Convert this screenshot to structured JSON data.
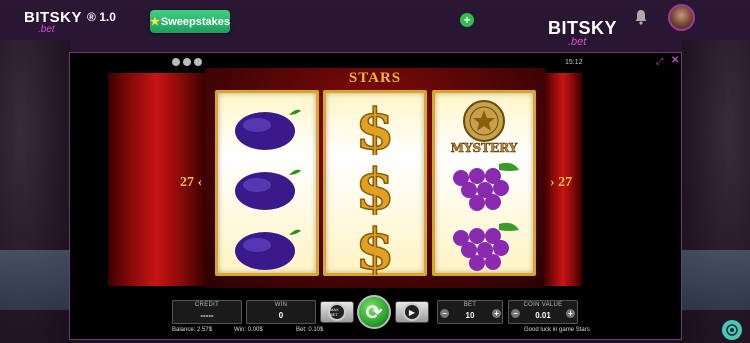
{
  "header": {
    "logo_text": "BITSKY",
    "logo_sub": ".bet",
    "version": "® 1.0",
    "sweep_label": "Sweepstakes",
    "logo2_text": "BITSKY",
    "logo2_sub": ".bet"
  },
  "colors": {
    "accent": "#e04bd6",
    "sweep_green": "#2fbf6a",
    "reel_gold": "#d9a62a",
    "curtain_red": "#c81414"
  },
  "game": {
    "title": "STARS",
    "lines_left": "27",
    "lines_right": "27",
    "clock": "15:12",
    "reels": [
      [
        "plum",
        "plum",
        "plum"
      ],
      [
        "dollar",
        "dollar",
        "dollar"
      ],
      [
        "mystery",
        "grapes",
        "grapes"
      ]
    ],
    "mystery_label": "MYSTERY"
  },
  "panel": {
    "credit_label": "CREDIT",
    "credit_value": "-----",
    "win_label": "WIN",
    "win_value": "0",
    "bet_label": "BET",
    "bet_value": "10",
    "coin_label": "COIN VALUE",
    "coin_value": "0.01",
    "maxbet_label": "MAX BET"
  },
  "status": {
    "balance": "Balance: 2.57$",
    "win": "Win: 0.00$",
    "bet": "Bet: 0.10$",
    "message": "Good luck in game Stars"
  },
  "icons": [
    "bell-icon",
    "add-icon",
    "sound-icon",
    "settings-icon",
    "info-icon",
    "resize-icon",
    "close-icon",
    "chat-icon",
    "spin-icon",
    "play-icon"
  ]
}
